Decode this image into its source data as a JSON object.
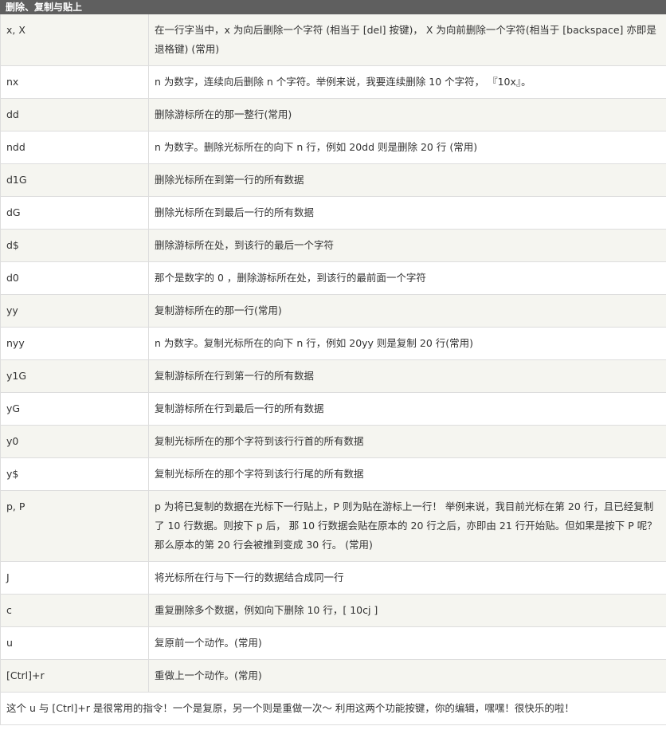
{
  "section": {
    "title": "删除、复制与贴上"
  },
  "rows": [
    {
      "key": "x, X",
      "desc": "在一行字当中，x 为向后删除一个字符 (相当于 [del] 按键)， X 为向前删除一个字符(相当于 [backspace] 亦即是退格键) (常用)"
    },
    {
      "key": "nx",
      "desc": "n 为数字，连续向后删除 n 个字符。举例来说，我要连续删除 10 个字符， 『10x』。"
    },
    {
      "key": "dd",
      "desc": "删除游标所在的那一整行(常用)"
    },
    {
      "key": "ndd",
      "desc": "n 为数字。删除光标所在的向下 n 行，例如 20dd 则是删除 20 行 (常用)"
    },
    {
      "key": "d1G",
      "desc": "删除光标所在到第一行的所有数据"
    },
    {
      "key": "dG",
      "desc": "删除光标所在到最后一行的所有数据"
    },
    {
      "key": "d$",
      "desc": "删除游标所在处，到该行的最后一个字符"
    },
    {
      "key": "d0",
      "desc": "那个是数字的 0 ，删除游标所在处，到该行的最前面一个字符"
    },
    {
      "key": "yy",
      "desc": "复制游标所在的那一行(常用)"
    },
    {
      "key": "nyy",
      "desc": "n 为数字。复制光标所在的向下 n 行，例如 20yy 则是复制 20 行(常用)"
    },
    {
      "key": "y1G",
      "desc": "复制游标所在行到第一行的所有数据"
    },
    {
      "key": "yG",
      "desc": "复制游标所在行到最后一行的所有数据"
    },
    {
      "key": "y0",
      "desc": "复制光标所在的那个字符到该行行首的所有数据"
    },
    {
      "key": "y$",
      "desc": "复制光标所在的那个字符到该行行尾的所有数据"
    },
    {
      "key": "p, P",
      "desc": "p 为将已复制的数据在光标下一行贴上，P 则为贴在游标上一行！ 举例来说，我目前光标在第 20 行，且已经复制了 10 行数据。则按下 p 后， 那 10 行数据会贴在原本的 20 行之后，亦即由 21 行开始贴。但如果是按下 P 呢？ 那么原本的第 20 行会被推到变成 30 行。 (常用)"
    },
    {
      "key": "J",
      "desc": "将光标所在行与下一行的数据结合成同一行"
    },
    {
      "key": "c",
      "desc": "重复删除多个数据，例如向下删除 10 行，[ 10cj ]"
    },
    {
      "key": "u",
      "desc": "复原前一个动作。(常用)"
    },
    {
      "key": "[Ctrl]+r",
      "desc": "重做上一个动作。(常用)"
    }
  ],
  "footer": {
    "note": "这个 u 与 [Ctrl]+r 是很常用的指令！一个是复原，另一个则是重做一次～ 利用这两个功能按键，你的编辑，嘿嘿！很快乐的啦！"
  }
}
